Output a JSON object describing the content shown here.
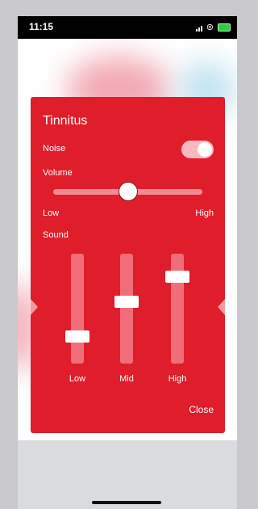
{
  "status_bar": {
    "time": "11:15",
    "signal_icon": "cellular-signal-icon",
    "link_icon": "hotspot-link-icon",
    "battery_icon": "battery-icon"
  },
  "panel": {
    "title": "Tinnitus",
    "noise": {
      "label": "Noise",
      "enabled": true
    },
    "volume": {
      "label": "Volume",
      "min_label": "Low",
      "max_label": "High",
      "level": 0.5
    },
    "sound": {
      "label": "Sound",
      "bands": [
        {
          "label": "Low",
          "level": 0.24
        },
        {
          "label": "Mid",
          "level": 0.56
        },
        {
          "label": "High",
          "level": 0.79
        }
      ]
    },
    "close_label": "Close"
  },
  "colors": {
    "panel": "#df1d2b",
    "toggle_on": "#f7b9bf",
    "track": "#f16d7a"
  }
}
